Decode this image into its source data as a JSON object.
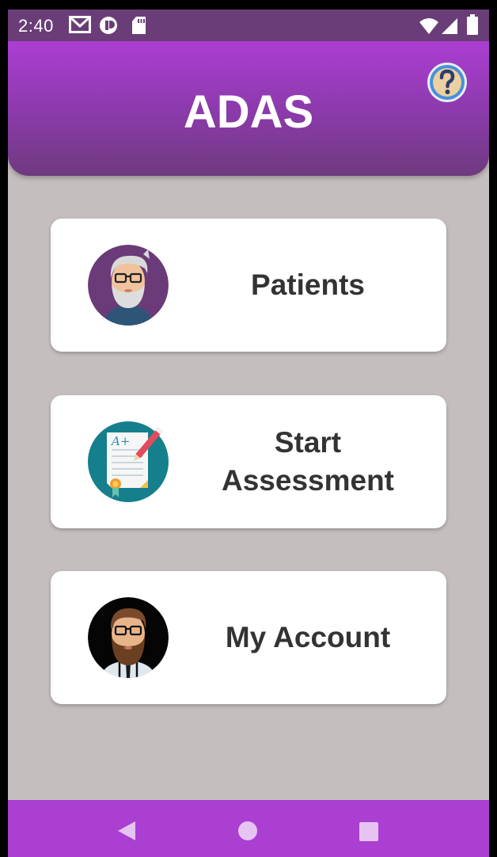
{
  "status_bar": {
    "time": "2:40",
    "left_icons": [
      "gmail-icon",
      "app-notification-icon",
      "sd-card-icon"
    ],
    "right_icons": [
      "wifi-icon",
      "cell-signal-icon",
      "battery-icon"
    ]
  },
  "header": {
    "title": "ADAS",
    "help_icon": "question-mark-icon",
    "background_top": "#ab3ed2",
    "background_bottom": "#6f3a7e"
  },
  "menu": {
    "patients": {
      "label": "Patients",
      "icon": "elderly-patient-avatar-icon"
    },
    "start_assessment": {
      "label_line1": "Start",
      "label_line2": "Assessment",
      "icon": "graded-test-paper-icon"
    },
    "my_account": {
      "label": "My Account",
      "icon": "bearded-man-avatar-icon"
    }
  },
  "nav_bar": {
    "buttons": [
      "back-icon",
      "home-icon",
      "recents-icon"
    ],
    "background": "#aa3fd1"
  },
  "colors": {
    "page_background": "#c4bfbe",
    "card_background": "#ffffff",
    "label_text": "#333333"
  }
}
